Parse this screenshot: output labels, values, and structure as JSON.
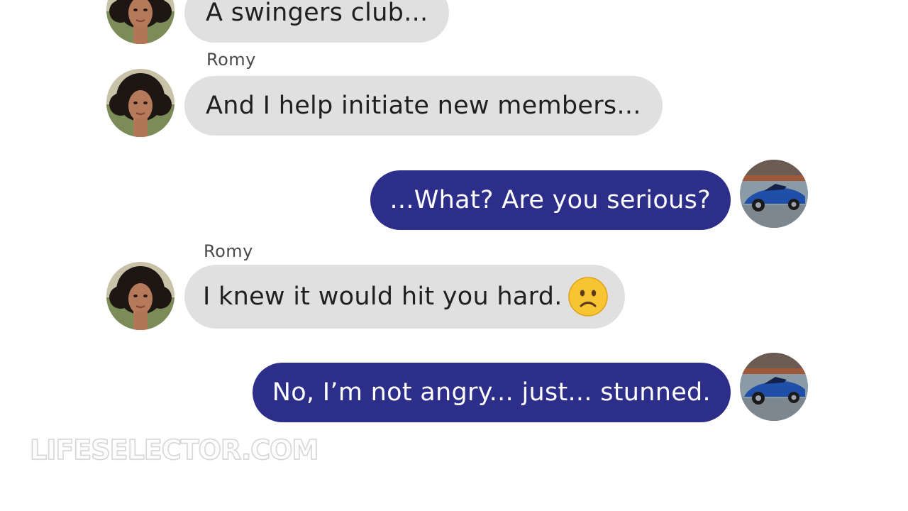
{
  "messages": [
    {
      "from": "Romy",
      "text": "A swingers club...",
      "direction": "incoming",
      "show_sender": false
    },
    {
      "from": "Romy",
      "text": "And I help initiate new members...",
      "direction": "incoming",
      "show_sender": true
    },
    {
      "from": "me",
      "text": "...What? Are you serious?",
      "direction": "outgoing"
    },
    {
      "from": "Romy",
      "text": "I knew it would hit you hard.",
      "direction": "incoming",
      "show_sender": true,
      "emoji": "slightly-frowning-face"
    },
    {
      "from": "me",
      "text": "No, I’m not angry... just... stunned.",
      "direction": "outgoing"
    }
  ],
  "watermark": "LIFESELECTOR.COM",
  "colors": {
    "incoming_bubble": "#e0e0e0",
    "outgoing_bubble": "#2c2e8a",
    "incoming_text": "#202020",
    "outgoing_text": "#ffffff",
    "sender_name": "#4a4a4a"
  }
}
